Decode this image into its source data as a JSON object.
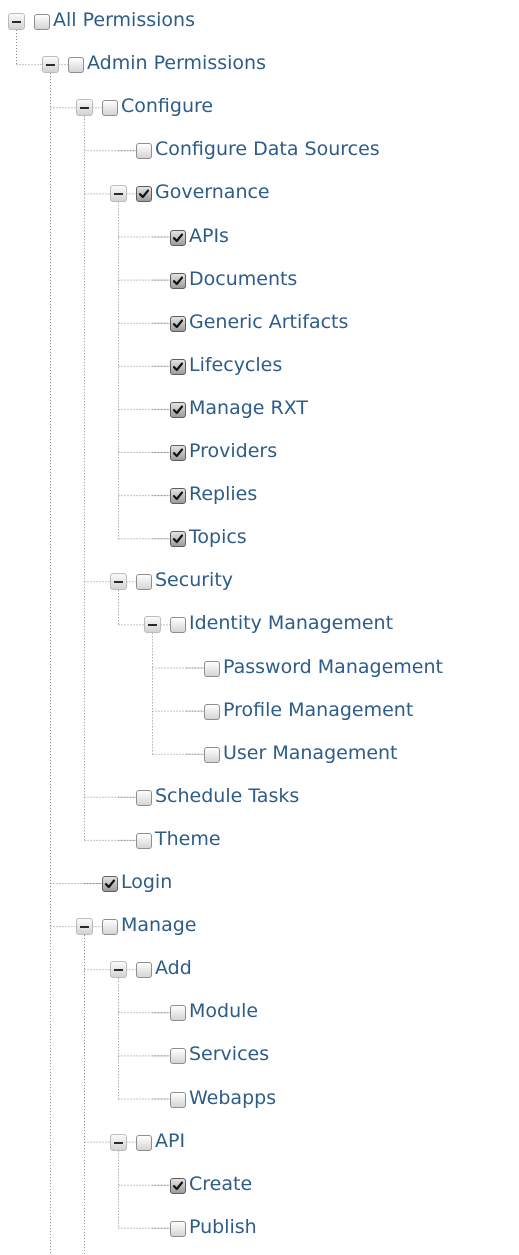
{
  "permissions_tree": {
    "label": "All Permissions",
    "expanded": true,
    "checked": false,
    "children": [
      {
        "label": "Admin Permissions",
        "expanded": true,
        "checked": false,
        "children": [
          {
            "label": "Configure",
            "expanded": true,
            "checked": false,
            "children": [
              {
                "label": "Configure Data Sources",
                "checked": false
              },
              {
                "label": "Governance",
                "expanded": true,
                "checked": true,
                "children": [
                  {
                    "label": "APIs",
                    "checked": true
                  },
                  {
                    "label": "Documents",
                    "checked": true
                  },
                  {
                    "label": "Generic Artifacts",
                    "checked": true
                  },
                  {
                    "label": "Lifecycles",
                    "checked": true
                  },
                  {
                    "label": "Manage RXT",
                    "checked": true
                  },
                  {
                    "label": "Providers",
                    "checked": true
                  },
                  {
                    "label": "Replies",
                    "checked": true
                  },
                  {
                    "label": "Topics",
                    "checked": true
                  }
                ]
              },
              {
                "label": "Security",
                "expanded": true,
                "checked": false,
                "children": [
                  {
                    "label": "Identity Management",
                    "expanded": true,
                    "checked": false,
                    "children": [
                      {
                        "label": "Password Management",
                        "checked": false
                      },
                      {
                        "label": "Profile Management",
                        "checked": false
                      },
                      {
                        "label": "User Management",
                        "checked": false
                      }
                    ]
                  }
                ]
              },
              {
                "label": "Schedule Tasks",
                "checked": false
              },
              {
                "label": "Theme",
                "checked": false
              }
            ]
          },
          {
            "label": "Login",
            "checked": true
          },
          {
            "label": "Manage",
            "expanded": true,
            "checked": false,
            "children": [
              {
                "label": "Add",
                "expanded": true,
                "checked": false,
                "children": [
                  {
                    "label": "Module",
                    "checked": false
                  },
                  {
                    "label": "Services",
                    "checked": false
                  },
                  {
                    "label": "Webapps",
                    "checked": false
                  }
                ]
              },
              {
                "label": "API",
                "expanded": true,
                "checked": false,
                "children": [
                  {
                    "label": "Create",
                    "checked": true
                  },
                  {
                    "label": "Publish",
                    "checked": false
                  }
                ]
              }
            ]
          }
        ]
      }
    ]
  },
  "colors": {
    "label_text": "#2d5c88",
    "connector_line": "#8a8a8a"
  },
  "icons": {
    "collapse_toggle": "minus-box-icon",
    "checkbox_checked": "checkmark-icon"
  }
}
